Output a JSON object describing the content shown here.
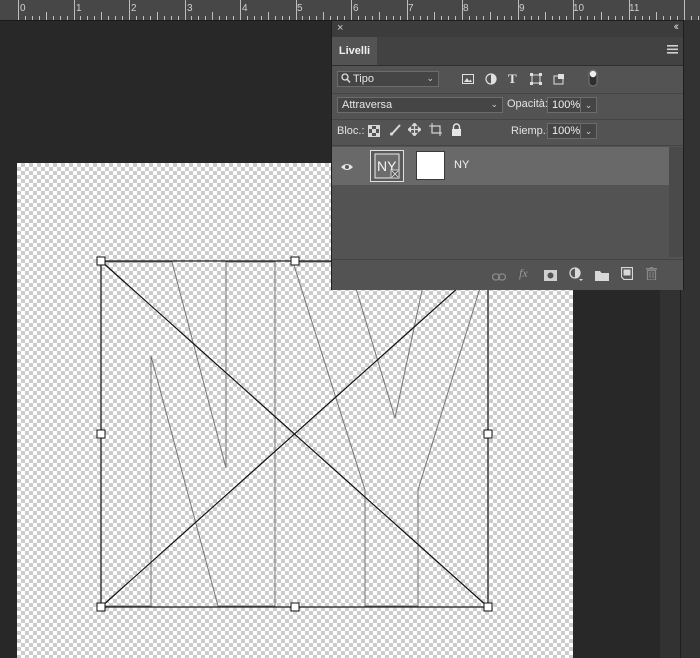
{
  "ruler": {
    "labels": [
      "0",
      "1",
      "2",
      "3",
      "4",
      "5",
      "6",
      "7",
      "8",
      "9",
      "10",
      "11"
    ]
  },
  "panel": {
    "close_glyph": "×",
    "collapse_glyph": "‹‹",
    "tab_label": "Livelli",
    "menu_icon": "panel-menu-icon",
    "filter": {
      "kind_value": "Tipo",
      "icons": [
        "image-filter-icon",
        "adjustment-filter-icon",
        "type-filter-icon",
        "shape-filter-icon",
        "smart-object-filter-icon",
        "filter-toggle-icon"
      ]
    },
    "blend": {
      "mode_value": "Attraversa",
      "opacity_label": "Opacità:",
      "opacity_value": "100%"
    },
    "lock": {
      "label": "Bloc.:",
      "icons": [
        "lock-transparency-icon",
        "lock-pixels-icon",
        "lock-position-icon",
        "lock-artboard-icon",
        "lock-all-icon"
      ],
      "fill_label": "Riemp.:",
      "fill_value": "100%"
    },
    "layer": {
      "name": "NY",
      "thumb_text": "NY",
      "visible": true
    },
    "footer_icons": [
      "link-layers-icon",
      "fx-icon",
      "add-mask-icon",
      "adjustment-layer-icon",
      "new-group-icon",
      "new-layer-icon",
      "delete-layer-icon"
    ]
  },
  "colors": {
    "workspace": "#282828",
    "panel_bg": "#535353",
    "selected_layer": "#696969",
    "ruler_bg": "#474747"
  }
}
